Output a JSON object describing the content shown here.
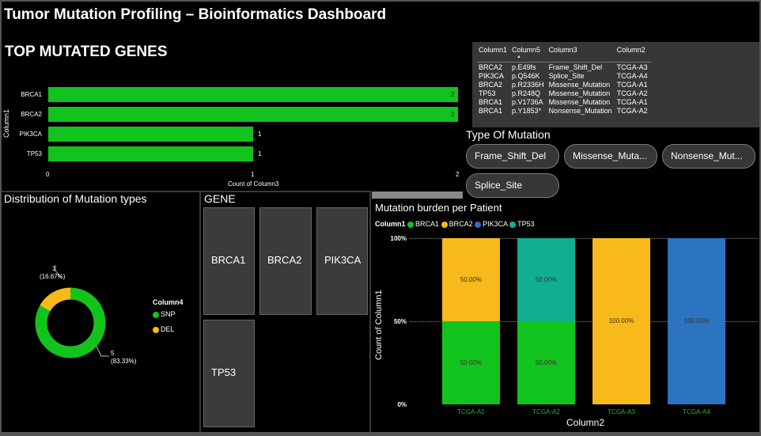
{
  "header": {
    "title": "Tumor Mutation Profiling – Bioinformatics Dashboard"
  },
  "top_genes": {
    "title": "TOP MUTATED GENES",
    "y_axis_label": "Column1",
    "x_axis_label": "Count of Column3",
    "ticks": [
      "0",
      "1",
      "2"
    ]
  },
  "mutation_table": {
    "columns": [
      "Column1",
      "Column5",
      "Column3",
      "Column2"
    ],
    "rows": [
      [
        "BRCA2",
        "p.E49fs",
        "Frame_Shift_Del",
        "TCGA-A3"
      ],
      [
        "PIK3CA",
        "p.Q546K",
        "Splice_Site",
        "TCGA-A4"
      ],
      [
        "BRCA2",
        "p.R2336H",
        "Missense_Mutation",
        "TCGA-A1"
      ],
      [
        "TP53",
        "p.R248Q",
        "Missense_Mutation",
        "TCGA-A2"
      ],
      [
        "BRCA1",
        "p.V1736A",
        "Missense_Mutation",
        "TCGA-A1"
      ],
      [
        "BRCA1",
        "p.Y1853*",
        "Nonsense_Mutation",
        "TCGA-A2"
      ]
    ]
  },
  "slicer": {
    "title": "Type Of Mutation",
    "options": [
      "Frame_Shift_Del",
      "Missense_Muta...",
      "Nonsense_Mut...",
      "Splice_Site"
    ]
  },
  "distribution": {
    "title": "Distribution of Mutation types",
    "legend_title": "Column4",
    "legend": [
      {
        "name": "SNP",
        "color": "#13c31d"
      },
      {
        "name": "DEL",
        "color": "#f8b91a"
      }
    ],
    "label_del_count": "1",
    "label_del_pct": "(16.67%)",
    "label_snp_count": "5",
    "label_snp_pct": "(83.33%)"
  },
  "gene_tiles": {
    "title": "GENE",
    "genes": [
      "BRCA1",
      "BRCA2",
      "PIK3CA",
      "TP53"
    ]
  },
  "burden": {
    "title": "Mutation burden per Patient",
    "legend_title": "Column1",
    "legend": [
      {
        "name": "BRCA1",
        "color": "#13c31d"
      },
      {
        "name": "BRCA2",
        "color": "#f8b91a"
      },
      {
        "name": "PIK3CA",
        "color": "#2c73c0"
      },
      {
        "name": "TP53",
        "color": "#12ae94"
      }
    ],
    "y_ticks": [
      "100%",
      "50%",
      "0%"
    ],
    "y_axis_label": "Count of Column1",
    "x_axis_label": "Column2"
  },
  "chart_data": [
    {
      "type": "bar",
      "orientation": "horizontal",
      "title": "TOP MUTATED GENES",
      "xlabel": "Count of Column3",
      "ylabel": "Column1",
      "categories": [
        "BRCA1",
        "BRCA2",
        "PIK3CA",
        "TP53"
      ],
      "values": [
        2,
        2,
        1,
        1
      ],
      "xlim": [
        0,
        2
      ],
      "color": "#13c31d"
    },
    {
      "type": "pie",
      "title": "Distribution of Mutation types",
      "legend_title": "Column4",
      "categories": [
        "SNP",
        "DEL"
      ],
      "values": [
        5,
        1
      ],
      "percentages": [
        "83.33%",
        "16.67%"
      ],
      "colors": [
        "#13c31d",
        "#f8b91a"
      ]
    },
    {
      "type": "bar",
      "stacked": "percent",
      "title": "Mutation burden per Patient",
      "xlabel": "Column2",
      "ylabel": "Count of Column1",
      "categories": [
        "TCGA-A1",
        "TCGA-A2",
        "TCGA-A3",
        "TCGA-A4"
      ],
      "series": [
        {
          "name": "BRCA1",
          "values": [
            50,
            50,
            0,
            0
          ],
          "color": "#13c31d"
        },
        {
          "name": "BRCA2",
          "values": [
            50,
            0,
            100,
            0
          ],
          "color": "#f8b91a"
        },
        {
          "name": "PIK3CA",
          "values": [
            0,
            0,
            0,
            100
          ],
          "color": "#2c73c0"
        },
        {
          "name": "TP53",
          "values": [
            0,
            50,
            0,
            0
          ],
          "color": "#12ae94"
        }
      ],
      "labels": [
        [
          "50.00%",
          "50.00%"
        ],
        [
          "50.00%",
          "50.00%"
        ],
        [
          "100.00%"
        ],
        [
          "100.00%"
        ]
      ],
      "ylim": [
        0,
        100
      ]
    }
  ]
}
